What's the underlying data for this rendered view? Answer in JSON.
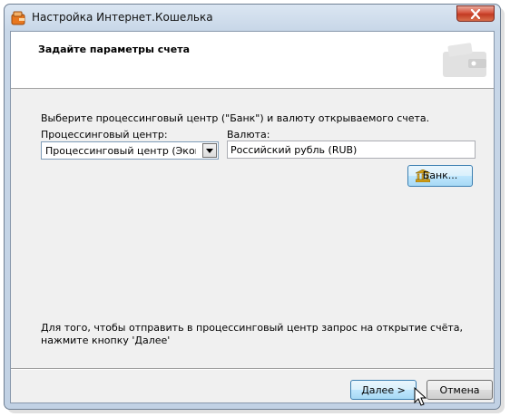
{
  "window": {
    "title": "Настройка Интернет.Кошелька",
    "icon": "wallet-app-icon"
  },
  "header": {
    "title": "Задайте параметры счета",
    "icon": "wallet-icon"
  },
  "main": {
    "instruction": "Выберите процессинговый центр (\"Банк\") и валюту открываемого счета.",
    "processing_center": {
      "label": "Процессинговый центр:",
      "value": "Процессинговый центр (Экомб"
    },
    "currency": {
      "label": "Валюта:",
      "value": "Российский рубль (RUB)"
    },
    "bank_button": {
      "label": "Банк...",
      "icon": "bank-icon"
    },
    "note": "Для того, чтобы отправить в процессинговый центр запрос на открытие счёта, нажмите кнопку 'Далее'"
  },
  "footer": {
    "next_label": "Далее >",
    "cancel_label": "Отмена"
  },
  "colors": {
    "accent": "#3c7fb1",
    "close_button": "#c23a22"
  }
}
